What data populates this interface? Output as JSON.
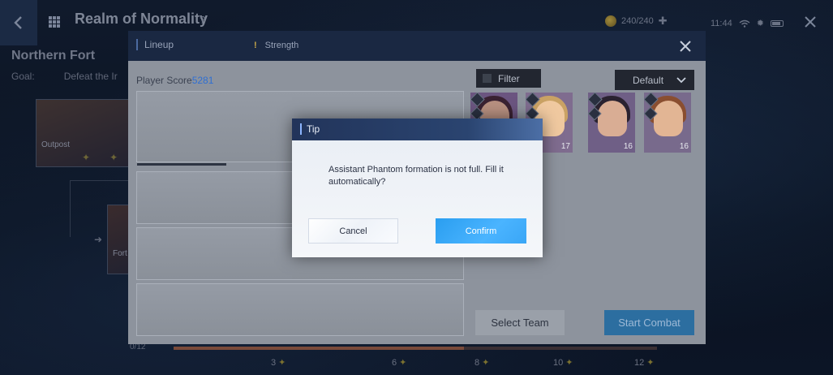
{
  "top_bar": {
    "realm_title": "Realm of Normality",
    "stamina": "240/240",
    "time": "11:44"
  },
  "map": {
    "fort_title": "Northern Fort",
    "goal_label": "Goal:",
    "goal_text": "Defeat the Ir",
    "stage_1_label": "Outpost",
    "stage_2_label": "Fort",
    "progress_count": "0/12",
    "progress_fraction": 0.6,
    "milestones": [
      "3",
      "6",
      "8",
      "10",
      "12"
    ]
  },
  "lineup": {
    "tab_label": "Lineup",
    "strength_label": "Strength",
    "player_score_label": "Player Score",
    "player_score_value": "5281",
    "filter_label": "Filter",
    "sort_label": "Default",
    "characters": [
      {
        "level": "",
        "skin": "#b89080",
        "hair": "#3a2232",
        "bg": "#6b5580"
      },
      {
        "level": "17",
        "skin": "#f0c9a0",
        "hair": "#caa264",
        "bg": "#7f6c8f"
      },
      {
        "level": "16",
        "skin": "#d9ad94",
        "hair": "#2a2230",
        "bg": "#6f5f86"
      },
      {
        "level": "16",
        "skin": "#e2b594",
        "hair": "#8a4e30",
        "bg": "#786a8c"
      }
    ],
    "select_team_label": "Select Team",
    "start_combat_label": "Start Combat"
  },
  "tip": {
    "title": "Tip",
    "message": "Assistant Phantom formation is not full. Fill it automatically?",
    "cancel_label": "Cancel",
    "confirm_label": "Confirm"
  },
  "colors": {
    "confirm": "#2a9ef0",
    "header": "#1a2842",
    "score_value": "#2f6fd2"
  }
}
